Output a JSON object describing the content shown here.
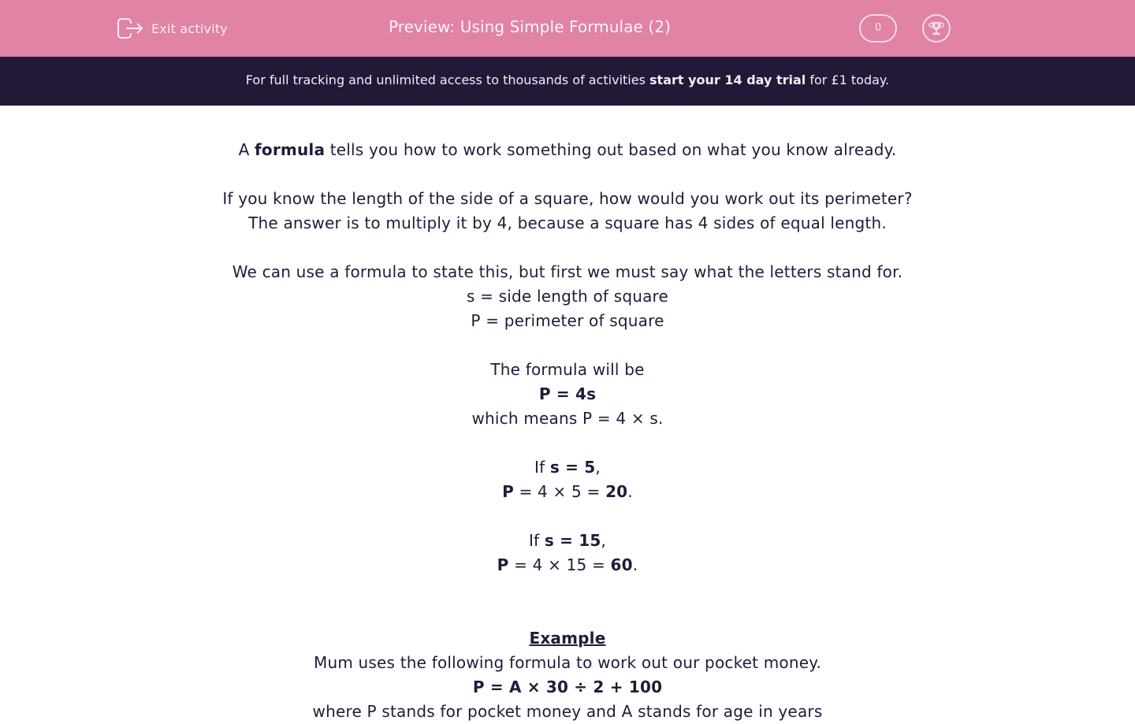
{
  "header": {
    "exit_label": "Exit activity",
    "title": "Preview: Using Simple Formulae (2)",
    "score": "0",
    "icons": {
      "exit": "exit-door-arrow-icon",
      "trophy": "trophy-icon"
    }
  },
  "banner": {
    "text_before": "For full tracking and unlimited access to thousands of activities ",
    "link_text": "start your 14 day trial",
    "text_after": " for £1 today."
  },
  "content": {
    "intro": {
      "a": "A ",
      "bold": "formula",
      "rest": " tells you how to work something out based on what you know already."
    },
    "question_line1": "If you know the length of the side of a square, how would you work out its perimeter?",
    "question_line2": "The answer is to multiply it by 4, because a square has 4 sides of equal length.",
    "letters_intro": "We can use a formula to state this, but first we must say what the letters stand for.",
    "def_s": "s = side length of square",
    "def_p": "P = perimeter of square",
    "formula_intro": "The formula will be",
    "formula": "P = 4s",
    "formula_meaning": "which means P = 4 × s.",
    "ex1": {
      "if": "If ",
      "cond": "s = 5",
      "comma": ",",
      "p": "P",
      "calc": " = 4 × 5 = ",
      "result": "20",
      "dot": "."
    },
    "ex2": {
      "if": "If ",
      "cond": "s = 15",
      "comma": ",",
      "p": "P",
      "calc": " = 4 × 15 = ",
      "result": "60",
      "dot": "."
    },
    "example_heading": "Example",
    "example_text": "Mum uses the following formula to work out our pocket money.",
    "example_formula": "P = A × 30 ÷ 2 + 100",
    "example_cutoff": "where P stands for pocket money and A stands for age in years"
  }
}
